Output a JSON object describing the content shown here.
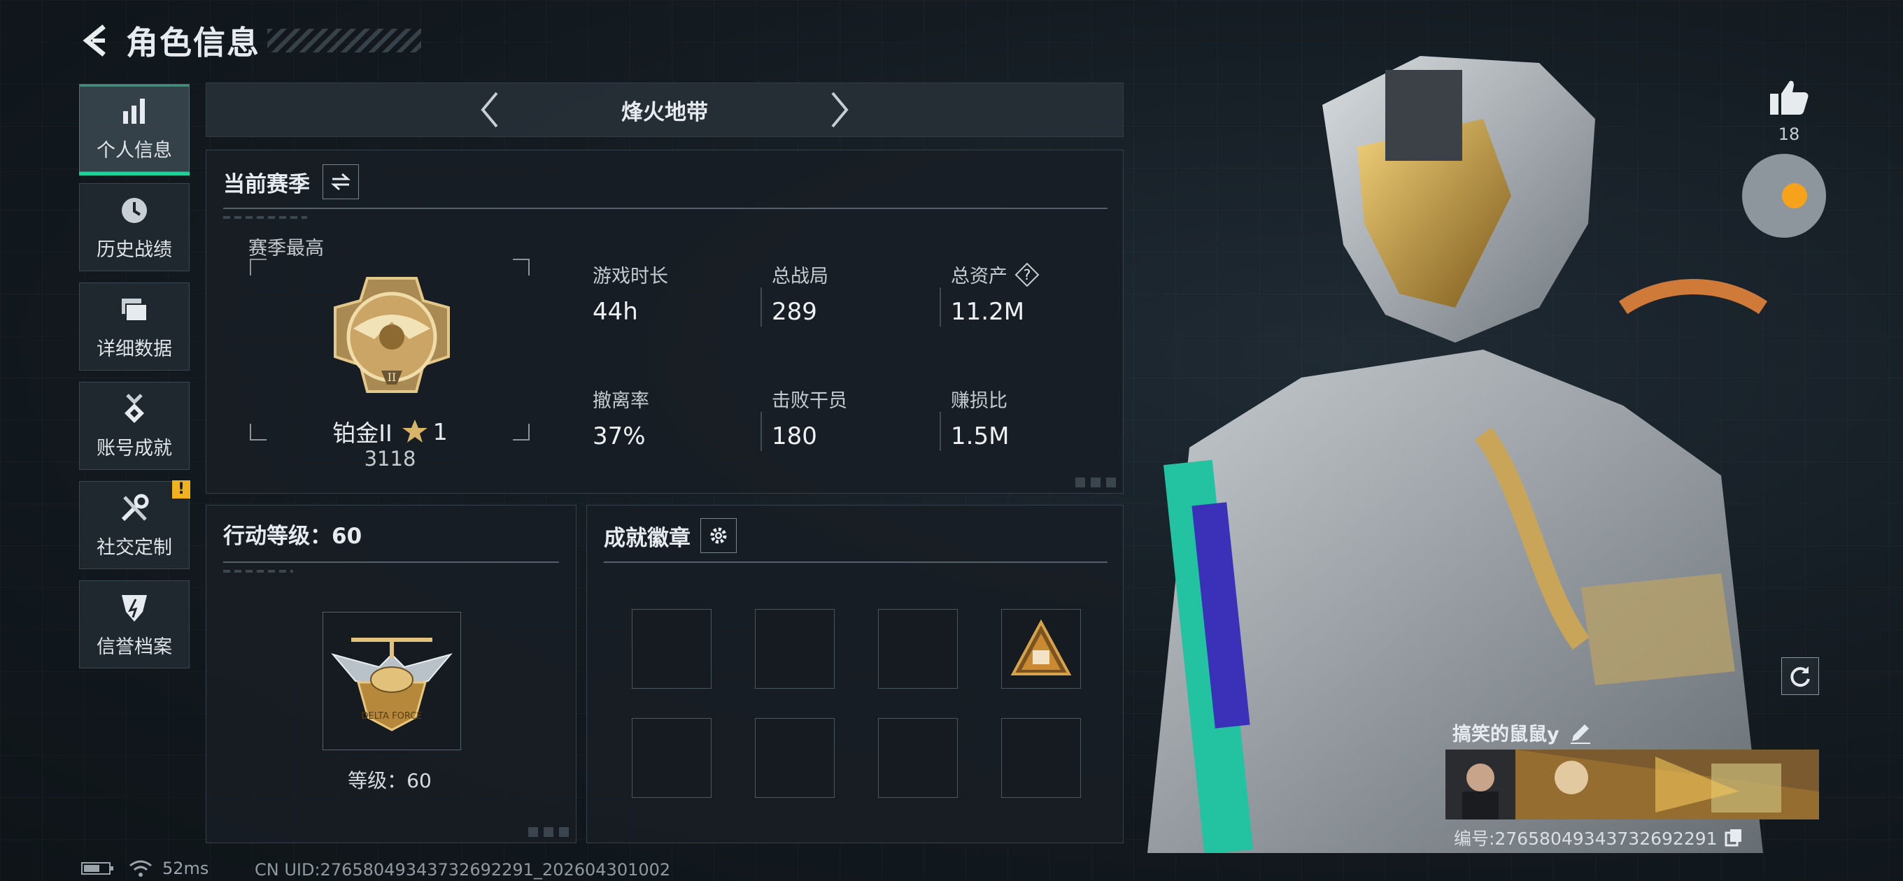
{
  "header": {
    "title": "角色信息",
    "back_icon": "back-arrow-icon"
  },
  "sidebar": {
    "items": [
      {
        "label": "个人信息",
        "icon": "bar-chart-icon",
        "active": true
      },
      {
        "label": "历史战绩",
        "icon": "history-clock-icon"
      },
      {
        "label": "详细数据",
        "icon": "folder-stack-icon"
      },
      {
        "label": "账号成就",
        "icon": "achievement-medal-icon"
      },
      {
        "label": "社交定制",
        "icon": "wrench-screwdriver-icon",
        "badge": "!"
      },
      {
        "label": "信誉档案",
        "icon": "credit-shield-icon"
      }
    ]
  },
  "mode": {
    "title": "烽火地带"
  },
  "season": {
    "title": "当前赛季",
    "peak_label": "赛季最高",
    "rank_name": "铂金II",
    "rank_stars": "1",
    "rank_score": "3118",
    "stats": [
      {
        "label": "游戏时长",
        "value": "44h"
      },
      {
        "label": "总战局",
        "value": "289"
      },
      {
        "label": "总资产",
        "value": "11.2M",
        "help": "?"
      },
      {
        "label": "撤离率",
        "value": "37%"
      },
      {
        "label": "击败干员",
        "value": "180"
      },
      {
        "label": "赚损比",
        "value": "1.5M"
      }
    ]
  },
  "level": {
    "title": "行动等级：60",
    "label": "等级：60",
    "emblem_text": "DELTA FORCE"
  },
  "badges": {
    "title": "成就徽章"
  },
  "profile": {
    "likes": "18",
    "player_name": "搞笑的鼠鼠y",
    "player_id": "编号:276580493437326922​91"
  },
  "status_bar": {
    "ping": "52ms",
    "uid": "CN UID:276580493437326922​91_202604301002"
  },
  "colors": {
    "accent": "#20d09a",
    "badge": "#f0b31f",
    "gold": "#c9a55a"
  }
}
